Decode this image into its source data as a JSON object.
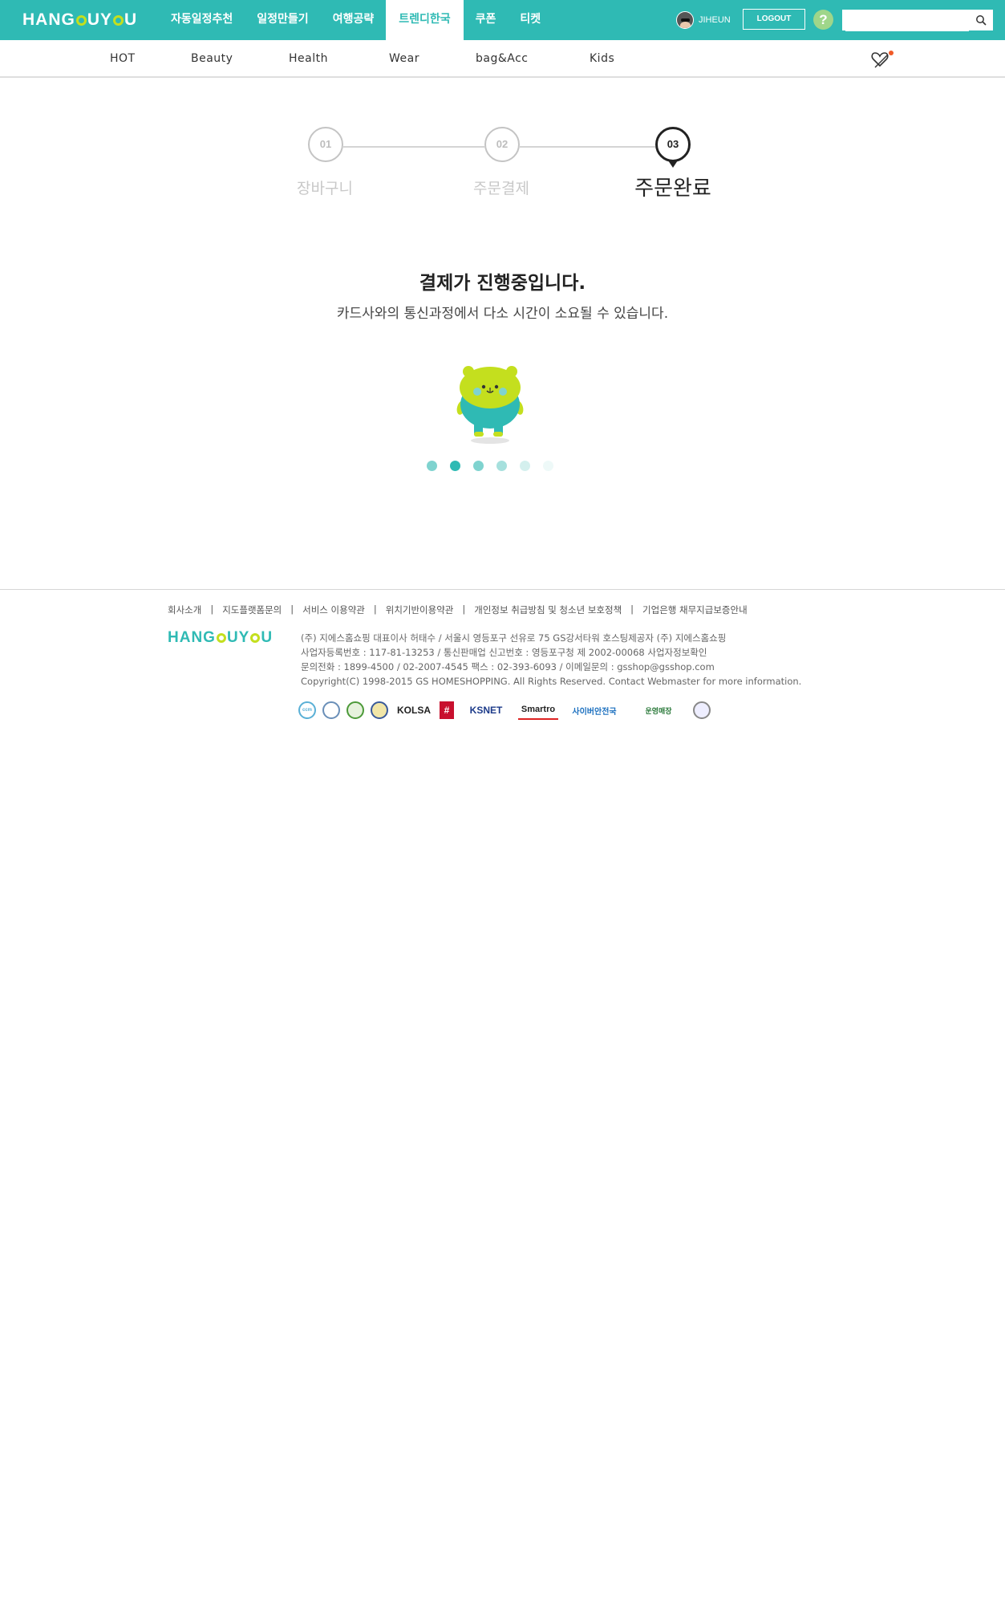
{
  "header": {
    "logo": {
      "part1": "HANG",
      "part2": "UY",
      "part3": "U"
    },
    "gnb": [
      {
        "label": "자동일정추천",
        "active": false
      },
      {
        "label": "일정만들기",
        "active": false
      },
      {
        "label": "여행공략",
        "active": false
      },
      {
        "label": "트렌디한국",
        "active": true
      },
      {
        "label": "쿠폰",
        "active": false
      },
      {
        "label": "티켓",
        "active": false
      }
    ],
    "username": "JIHEUN",
    "logout_label": "LOGOUT",
    "help_label": "?",
    "search": {
      "value": "",
      "placeholder": ""
    }
  },
  "subnav": [
    "HOT",
    "Beauty",
    "Health",
    "Wear",
    "bag&Acc",
    "Kids"
  ],
  "steps": [
    {
      "num": "01",
      "label": "장바구니",
      "current": false
    },
    {
      "num": "02",
      "label": "주문결제",
      "current": false
    },
    {
      "num": "03",
      "label": "주문완료",
      "current": true
    }
  ],
  "message": {
    "title": "결제가 진행중입니다.",
    "subtitle": "카드사와의 통신과정에서 다소 시간이 소요될 수 있습니다."
  },
  "loading": {
    "dots": 6,
    "active_dot": 2
  },
  "footer": {
    "links": [
      "회사소개",
      "지도플랫폼문의",
      "서비스 이용약관",
      "위치기반이용약관",
      "개인정보 취급방침 및 청소년 보호정책",
      "기업은행 채무지급보증안내"
    ],
    "company_lines": [
      "(주) 지에스홈쇼핑 대표이사 허태수 / 서울시 영등포구 선유로 75 GS강서타워 호스팅제공자 (주) 지에스홈쇼핑",
      "사업자등록번호 : 117-81-13253 / 통신판매업 신고번호 : 영등포구청 제 2002-00068 사업자정보확인",
      "문의전화 : 1899-4500 / 02-2007-4545 팩스 : 02-393-6093 / 이메일문의 : gsshop@gsshop.com",
      "Copyright(C) 1998-2015 GS HOMESHOPPING. All Rights Reserved. Contact Webmaster for more information."
    ],
    "certs": [
      "ccm",
      "KOLSA",
      "KSNET",
      "Smartro",
      "사이버안전국",
      "운영매장"
    ]
  },
  "colors": {
    "brand": "#2fbab4",
    "accent": "#c4df1e"
  }
}
